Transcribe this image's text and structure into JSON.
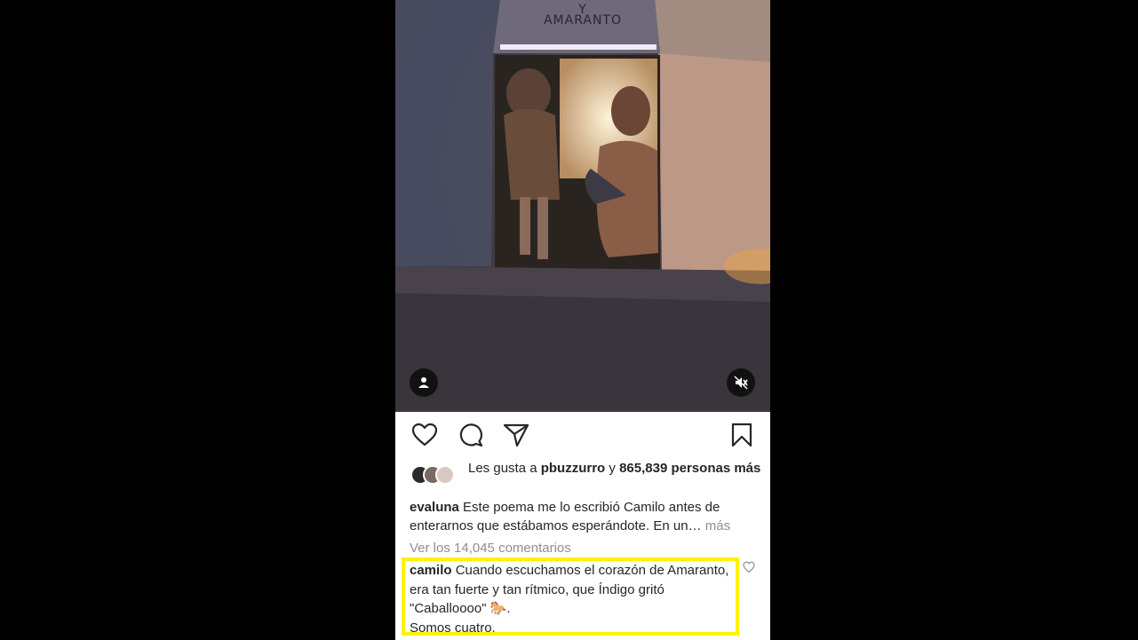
{
  "media": {
    "sign_text": "AMARANTO",
    "sign_text_top": "Y"
  },
  "icons": {
    "profile": "person-icon",
    "mute": "muted-speaker-icon",
    "like": "heart-icon",
    "comment": "comment-bubble-icon",
    "share": "paper-plane-icon",
    "save": "bookmark-icon"
  },
  "likes": {
    "prefix": "Les gusta a ",
    "user": "pbuzzurro",
    "middle": " y ",
    "count": "865,839 personas más"
  },
  "caption": {
    "user": "evaluna",
    "text": " Este poema me lo escribió Camilo antes de enterarnos que estábamos esperándote. En un…",
    "more": " más"
  },
  "view_comments": "Ver los 14,045 comentarios",
  "comment": {
    "user": "camilo",
    "text": " Cuando escuchamos el corazón de Amaranto, era tan fuerte y tan rítmico, que Índigo gritó \"Caballoooo\" 🐎.",
    "text2": "Somos cuatro."
  },
  "colors": {
    "highlight": "#fff200",
    "background": "#000000",
    "text": "#262626",
    "muted": "#8e8e8e"
  }
}
